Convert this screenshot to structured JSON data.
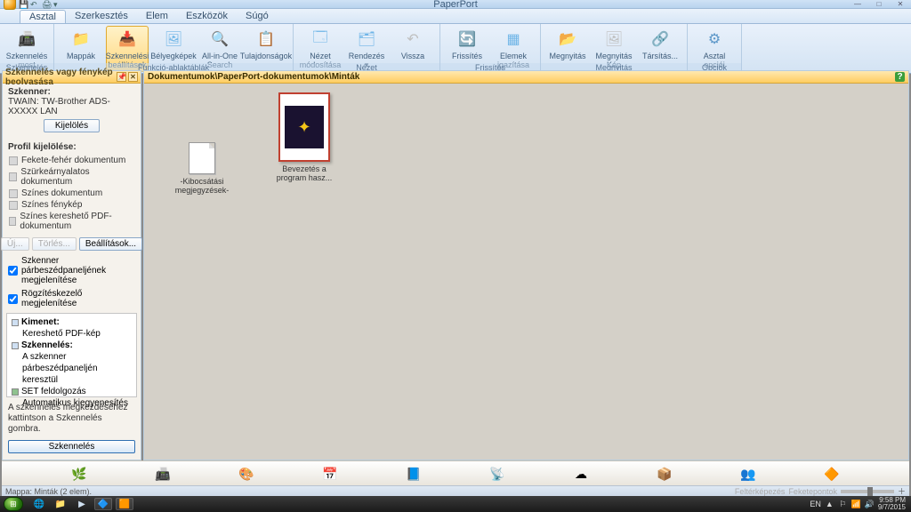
{
  "window": {
    "title": "PaperPort",
    "controls": {
      "min": "—",
      "max": "□",
      "close": "✕"
    }
  },
  "menu": {
    "items": [
      "Asztal",
      "Szerkesztés",
      "Elem",
      "Eszközök",
      "Súgó"
    ],
    "active": 0
  },
  "ribbon": {
    "groups": [
      {
        "label": "Szkennelés",
        "buttons": [
          {
            "name": "scan-now",
            "label": "Szkennelés\nmost",
            "icon": "📠",
            "color": "#4a90d9"
          }
        ]
      },
      {
        "label": "Funkció-ablaktáblák",
        "buttons": [
          {
            "name": "folders",
            "label": "Mappák",
            "icon": "📁",
            "color": "#f0c24b"
          },
          {
            "name": "scan-settings",
            "label": "Szkennelési\nbeállítások",
            "icon": "📥",
            "color": "#ff9a3c",
            "selected": true
          },
          {
            "name": "thumbnails",
            "label": "Bélyegképek",
            "icon": "🖼",
            "color": "#6fb5e7"
          },
          {
            "name": "allinone",
            "label": "All-in-One\nSearch",
            "icon": "🔍",
            "color": "#6fb5e7"
          },
          {
            "name": "properties",
            "label": "Tulajdonságok",
            "icon": "📋",
            "color": "#6fb5e7"
          }
        ]
      },
      {
        "label": "Nézet",
        "buttons": [
          {
            "name": "view-edit",
            "label": "Nézet\nmódosítása ▾",
            "icon": "🗔",
            "color": "#6fb5e7"
          },
          {
            "name": "sort",
            "label": "Rendezés ▾",
            "icon": "🗂",
            "color": "#6fb5e7"
          },
          {
            "name": "back",
            "label": "Vissza",
            "icon": "↶",
            "color": "#bfbfbf"
          }
        ]
      },
      {
        "label": "Frissítés",
        "buttons": [
          {
            "name": "refresh",
            "label": "Frissítés",
            "icon": "🔄",
            "color": "#63b863"
          },
          {
            "name": "align-items",
            "label": "Elemek\nigazítása",
            "icon": "▦",
            "color": "#6fb5e7"
          }
        ]
      },
      {
        "label": "Megnyitás",
        "buttons": [
          {
            "name": "open",
            "label": "Megnyitás",
            "icon": "📂",
            "color": "#bfbfbf"
          },
          {
            "name": "open-imgview",
            "label": "Megnyitás\nKép nézetben",
            "icon": "🖼",
            "color": "#bfbfbf"
          },
          {
            "name": "pair",
            "label": "Társítás...",
            "icon": "🔗",
            "color": "#bfbfbf"
          }
        ]
      },
      {
        "label": "Opciók",
        "buttons": [
          {
            "name": "desktop-options",
            "label": "Asztal\nopciói",
            "icon": "⚙",
            "color": "#5a96c8"
          }
        ]
      }
    ]
  },
  "leftPanel": {
    "title": "Szkennelés vagy fénykép beolvasása",
    "scannerLabel": "Szkenner:",
    "scanner": "TWAIN: TW-Brother ADS-XXXXX  LAN",
    "selectBtn": "Kijelölés",
    "profileLabel": "Profil kijelölése:",
    "profiles": [
      "Fekete-fehér dokumentum",
      "Szürkeárnyalatos dokumentum",
      "Színes dokumentum",
      "Színes fénykép",
      "Színes kereshető PDF-dokumentum"
    ],
    "buttons": {
      "new": "Új...",
      "delete": "Törlés...",
      "settings": "Beállítások..."
    },
    "check1": "Szkenner párbeszédpaneljének megjelenítése",
    "check2": "Rögzítéskezelő megjelenítése",
    "output": {
      "kimenet": "Kimenet:",
      "kimenet_val": "Kereshető PDF-kép",
      "szkenneles": "Szkennelés:",
      "szkenneles_val": "A szkenner párbeszédpaneljén keresztül",
      "set": "SET feldolgozás",
      "auto": "Automatikus kiegyenesítés"
    },
    "footer_note": "A szkennelés megkezdéséhez kattintson a Szkennelés gombra.",
    "scanBtn": "Szkennelés"
  },
  "rightPanel": {
    "path": "Dokumentumok\\PaperPort-dokumentumok\\Minták",
    "item1": "-Kibocsátási megjegyzések-",
    "item2": "Bevezetés a program hasz..."
  },
  "appbar_icons": [
    "evernote-icon",
    "scanner-icon",
    "paint-icon",
    "calendar-icon",
    "note-icon",
    "ftp-icon",
    "cloud-icon",
    "box-icon",
    "people-icon",
    "app-icon"
  ],
  "statusbar": {
    "left": "Mappa: Minták (2 elem).",
    "labels": [
      "Feltérképezés",
      "Feketepontok"
    ]
  },
  "taskbar": {
    "lang": "EN",
    "time": "9:58 PM",
    "date": "9/7/2015"
  }
}
